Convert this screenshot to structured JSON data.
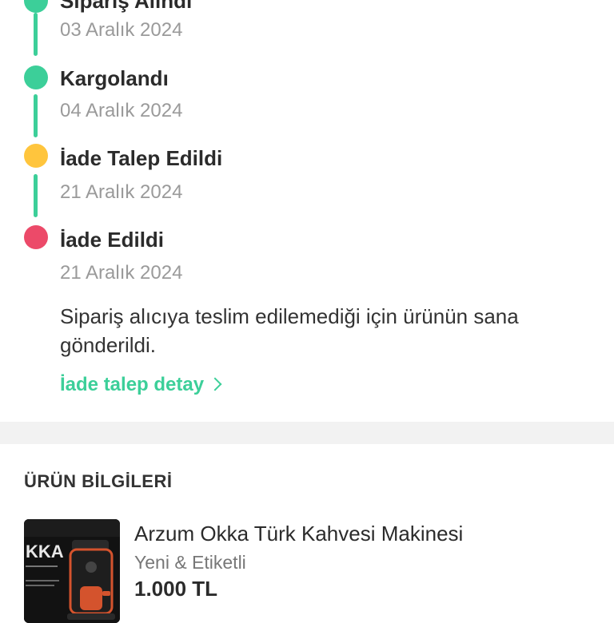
{
  "timeline": {
    "steps": [
      {
        "title": "Sipariş Alındı",
        "date": "03 Aralık 2024",
        "status_color": "#3ccf99"
      },
      {
        "title": "Kargolandı",
        "date": "04 Aralık 2024",
        "status_color": "#3ccf99"
      },
      {
        "title": "İade Talep Edildi",
        "date": "21 Aralık 2024",
        "status_color": "#ffc53d"
      },
      {
        "title": "İade Edildi",
        "date": "21 Aralık 2024",
        "status_color": "#ec4a69"
      }
    ],
    "line_color": "#3ccf99",
    "note": "Sipariş alıcıya teslim edilemediği için ürünün sana gönderildi.",
    "detail_link": "İade talep detay"
  },
  "product_section": {
    "title": "ÜRÜN BİLGİLERİ",
    "product": {
      "name": "Arzum Okka Türk Kahvesi Makinesi",
      "condition": "Yeni & Etiketli",
      "price": "1.000 TL",
      "image_icon": "coffee-machine-box-image",
      "image_text": "KKA"
    }
  },
  "colors": {
    "accent": "#3ccf99",
    "separator": "#f2f2f2"
  }
}
